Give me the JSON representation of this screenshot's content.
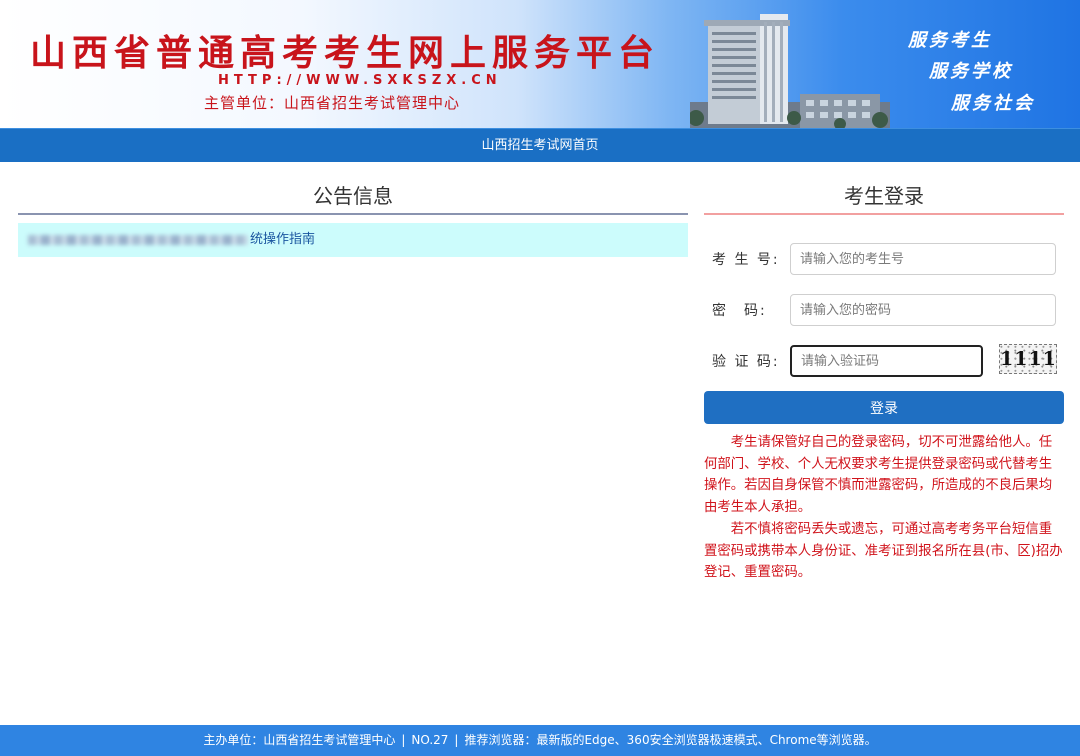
{
  "banner": {
    "title": "山西省普通高考考生网上服务平台",
    "url": "HTTP://WWW.SXKSZX.CN",
    "sponsor": "主管单位：山西省招生考试管理中心",
    "slogans": [
      "服务考生",
      "服务学校",
      "服务社会"
    ],
    "colors": {
      "title": "#c8141b",
      "slogan": "#ffffff"
    }
  },
  "navbar": {
    "home_link": "山西招生考试网首页",
    "color": "#1a6fc4"
  },
  "announcements": {
    "title": "公告信息",
    "items": [
      {
        "visible_text": "统操作指南",
        "obscured": true
      }
    ]
  },
  "login": {
    "title": "考生登录",
    "fields": {
      "candidate_no": {
        "label": "考 生 号:",
        "value": "",
        "placeholder": "请输入您的考生号"
      },
      "password": {
        "label": "密　码:",
        "value": "",
        "placeholder": "请输入您的密码"
      },
      "captcha": {
        "label": "验 证 码:",
        "value": "",
        "placeholder": "请输入验证码"
      }
    },
    "captcha_image_text": "1111",
    "submit_label": "登录",
    "notices": [
      "考生请保管好自己的登录密码，切不可泄露给他人。任何部门、学校、个人无权要求考生提供登录密码或代替考生操作。若因自身保管不慎而泄露密码，所造成的不良后果均由考生本人承担。",
      "若不慎将密码丢失或遗忘，可通过高考考务平台短信重置密码或携带本人身份证、准考证到报名所在县(市、区)招办登记、重置密码。"
    ],
    "colors": {
      "button": "#1f6fc2",
      "notice": "#d0131b"
    }
  },
  "footer": {
    "organizer": "主办单位：山西省招生考试管理中心",
    "number": "NO.27",
    "browsers": "推荐浏览器：最新版的Edge、360安全浏览器极速模式、Chrome等浏览器。",
    "separator": "|",
    "color": "#2f84e2"
  }
}
